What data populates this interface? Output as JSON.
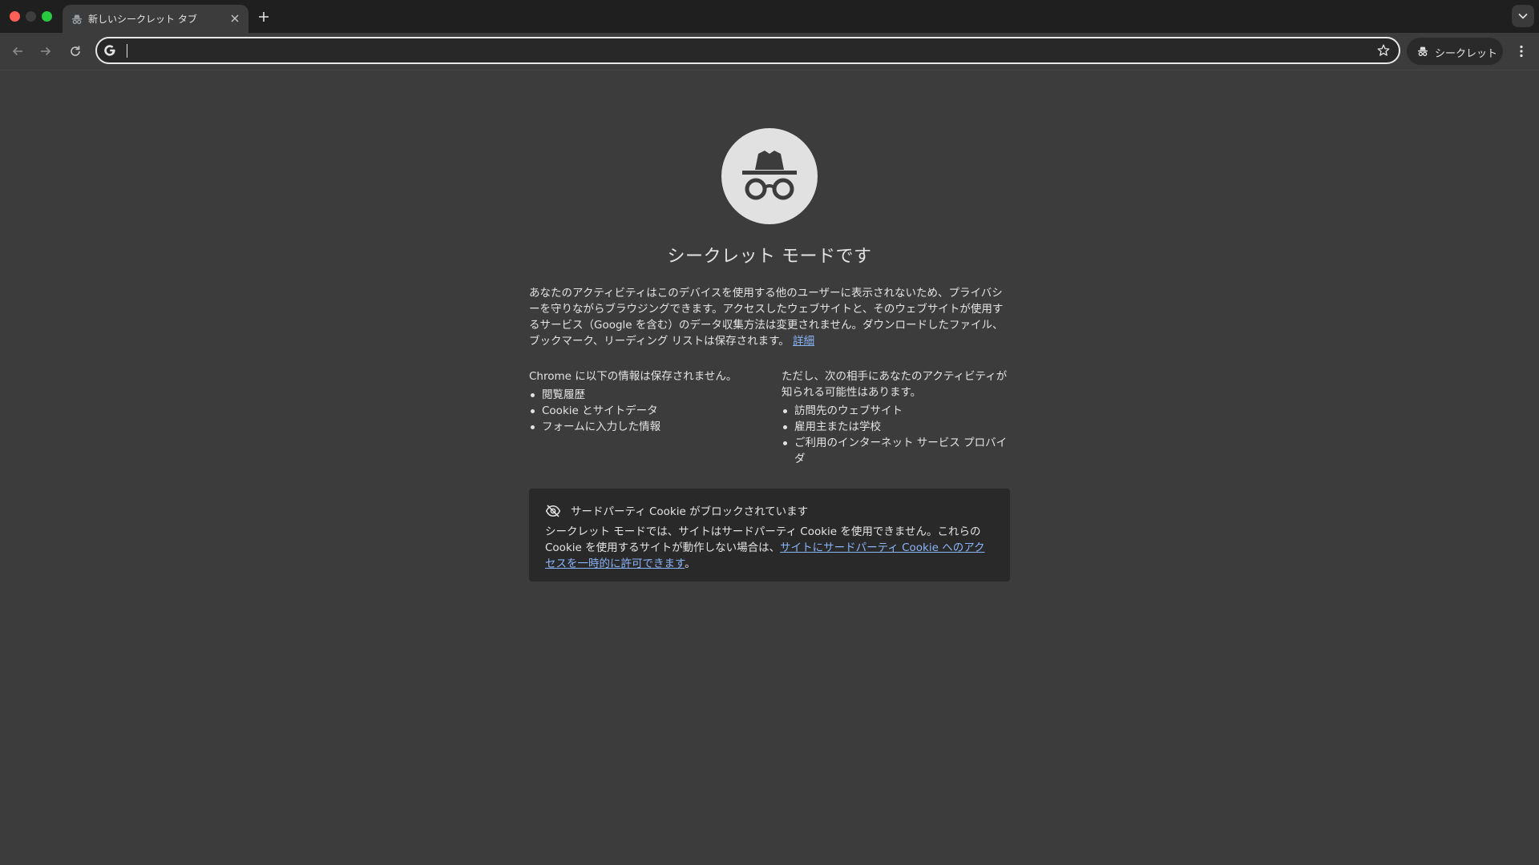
{
  "browser": {
    "tab": {
      "title": "新しいシークレット タブ"
    },
    "omnibox": {
      "value": "",
      "placeholder": ""
    },
    "profile_chip": {
      "label": "シークレット"
    }
  },
  "page": {
    "heading": "シークレット モードです",
    "intro": "あなたのアクティビティはこのデバイスを使用する他のユーザーに表示されないため、プライバシーを守りながらブラウジングできます。アクセスしたウェブサイトと、そのウェブサイトが使用するサービス（Google を含む）のデータ収集方法は変更されません。ダウンロードしたファイル、ブックマーク、リーディング リストは保存されます。",
    "intro_link": "詳細",
    "not_saved": {
      "title": "Chrome に以下の情報は保存されません。",
      "items": [
        "閲覧履歴",
        "Cookie とサイトデータ",
        "フォームに入力した情報"
      ]
    },
    "may_see": {
      "title": "ただし、次の相手にあなたのアクティビティが知られる可能性はあります。",
      "items": [
        "訪問先のウェブサイト",
        "雇用主または学校",
        "ご利用のインターネット サービス プロバイダ"
      ]
    },
    "cookie_card": {
      "title": "サードパーティ Cookie がブロックされています",
      "body": "シークレット モードでは、サイトはサードパーティ Cookie を使用できません。これらの Cookie を使用するサイトが動作しない場合は、",
      "link": "サイトにサードパーティ Cookie へのアクセスを一時的に許可できます",
      "end": "。"
    }
  },
  "icons": {
    "tab": "incognito-icon",
    "hero": "incognito-icon",
    "cookie": "eye-off-icon",
    "omnibox": "google-g-icon",
    "bookmark": "star-outline-icon"
  },
  "colors": {
    "page_bg": "#3c3c3c",
    "tabstrip_bg": "#1f1f1f",
    "card_bg": "#292929",
    "link": "#8ab4f8",
    "text": "#e3e3e3",
    "hero_circle": "#e1e1e1"
  }
}
